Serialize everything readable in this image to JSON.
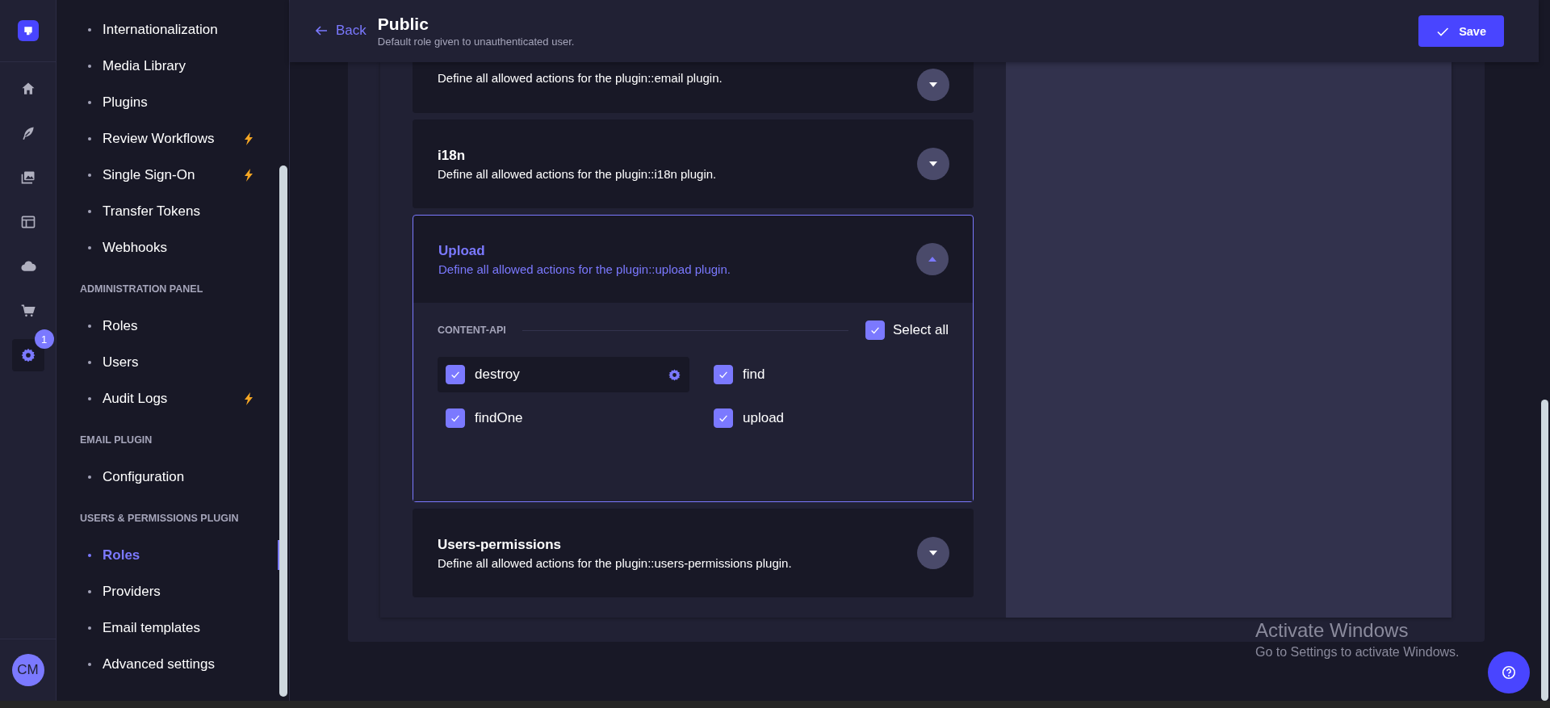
{
  "rail": {
    "items": [
      {
        "kind": "home",
        "selected": false
      },
      {
        "kind": "feather",
        "selected": false
      },
      {
        "kind": "images",
        "selected": false
      },
      {
        "kind": "layout",
        "selected": false
      },
      {
        "kind": "cloud",
        "selected": false
      },
      {
        "kind": "cart",
        "selected": false
      },
      {
        "kind": "gear",
        "selected": true,
        "badge": "1"
      }
    ],
    "avatar": "CM"
  },
  "sidebar": {
    "sections": [
      {
        "items": [
          {
            "label": "Internationalization",
            "selected": false,
            "premium": false
          },
          {
            "label": "Media Library",
            "selected": false,
            "premium": false
          },
          {
            "label": "Plugins",
            "selected": false,
            "premium": false
          },
          {
            "label": "Review Workflows",
            "selected": false,
            "premium": true
          },
          {
            "label": "Single Sign-On",
            "selected": false,
            "premium": true
          },
          {
            "label": "Transfer Tokens",
            "selected": false,
            "premium": false
          },
          {
            "label": "Webhooks",
            "selected": false,
            "premium": false
          }
        ]
      },
      {
        "title": "ADMINISTRATION PANEL",
        "items": [
          {
            "label": "Roles",
            "selected": false,
            "premium": false
          },
          {
            "label": "Users",
            "selected": false,
            "premium": false
          },
          {
            "label": "Audit Logs",
            "selected": false,
            "premium": true
          }
        ]
      },
      {
        "title": "EMAIL PLUGIN",
        "items": [
          {
            "label": "Configuration",
            "selected": false,
            "premium": false
          }
        ]
      },
      {
        "title": "USERS & PERMISSIONS PLUGIN",
        "items": [
          {
            "label": "Roles",
            "selected": true,
            "premium": false
          },
          {
            "label": "Providers",
            "selected": false,
            "premium": false
          },
          {
            "label": "Email templates",
            "selected": false,
            "premium": false
          },
          {
            "label": "Advanced settings",
            "selected": false,
            "premium": false
          }
        ]
      }
    ]
  },
  "header": {
    "back": "Back",
    "title": "Public",
    "subtitle": "Default role given to unauthenticated user.",
    "save": "Save"
  },
  "plugins": [
    {
      "description": "Define all allowed actions for the plugin::email plugin.",
      "expanded": false
    },
    {
      "title": "i18n",
      "description": "Define all allowed actions for the plugin::i18n plugin.",
      "expanded": false
    },
    {
      "title": "Upload",
      "description": "Define all allowed actions for the plugin::upload plugin.",
      "expanded": true,
      "sections": [
        {
          "title": "CONTENT-API",
          "select_all": {
            "label": "Select all",
            "checked": true
          },
          "actions": [
            {
              "label": "destroy",
              "checked": true,
              "selected": true
            },
            {
              "label": "find",
              "checked": true,
              "selected": false
            },
            {
              "label": "findOne",
              "checked": true,
              "selected": false
            },
            {
              "label": "upload",
              "checked": true,
              "selected": false
            }
          ]
        }
      ]
    },
    {
      "title": "Users-permissions",
      "description": "Define all allowed actions for the plugin::users-permissions plugin.",
      "expanded": false
    }
  ],
  "os_notice": {
    "title": "Activate Windows",
    "text": "Go to Settings to activate Windows."
  }
}
